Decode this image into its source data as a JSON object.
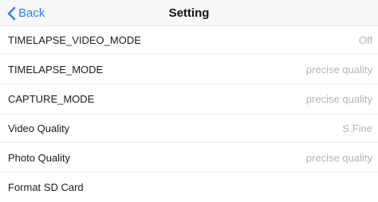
{
  "navbar": {
    "back_label": "Back",
    "title": "Setting",
    "accent_color": "#2f7ff5",
    "back_icon": "chevron-left-icon"
  },
  "settings": [
    {
      "label": "TIMELAPSE_VIDEO_MODE",
      "value": "Off"
    },
    {
      "label": "TIMELAPSE_MODE",
      "value": "precise quality"
    },
    {
      "label": "CAPTURE_MODE",
      "value": "precise quality"
    },
    {
      "label": "Video Quality",
      "value": "S.Fine"
    },
    {
      "label": "Photo Quality",
      "value": "precise quality"
    },
    {
      "label": "Format SD Card",
      "value": ""
    }
  ]
}
